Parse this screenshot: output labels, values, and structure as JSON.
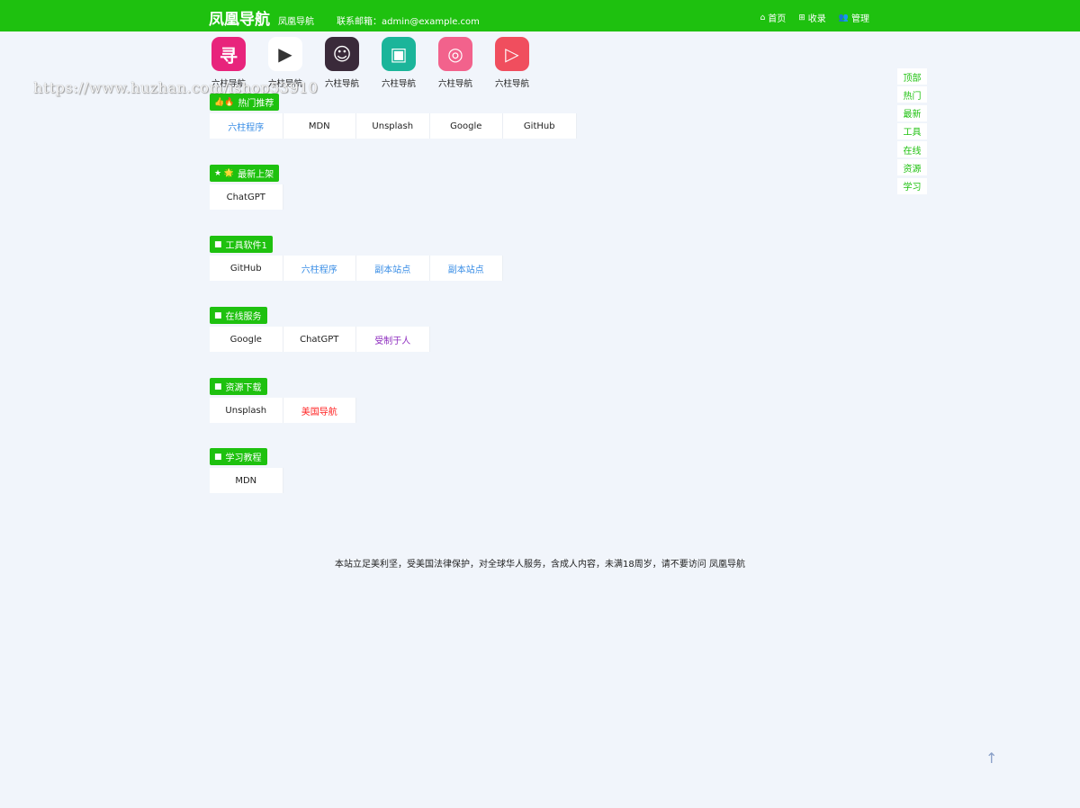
{
  "header": {
    "brand": "凤凰导航",
    "brand_sub": "凤凰导航",
    "contact": "联系邮箱：admin@example.com",
    "nav": [
      {
        "icon": "home-icon",
        "glyph": "⌂",
        "label": "首页"
      },
      {
        "icon": "plus-square-icon",
        "glyph": "⊞",
        "label": "收录"
      },
      {
        "icon": "users-icon",
        "glyph": "👥",
        "label": "管理"
      }
    ]
  },
  "watermark": "https://www.huzhan.com/ishop53910",
  "apps": [
    {
      "label": "六柱导航",
      "color": "#e8247c",
      "glyph": "寻"
    },
    {
      "label": "六柱导航",
      "color": "#ffffff",
      "glyph": "▶"
    },
    {
      "label": "六柱导航",
      "color": "#3a2a3a",
      "glyph": "☺"
    },
    {
      "label": "六柱导航",
      "color": "#1bb59a",
      "glyph": "▣"
    },
    {
      "label": "六柱导航",
      "color": "#f2628c",
      "glyph": "◎"
    },
    {
      "label": "六柱导航",
      "color": "#f04e5e",
      "glyph": "▷"
    }
  ],
  "sections": [
    {
      "id": "hot",
      "icon": "thumbs-up-icon",
      "glyph": "👍🔥",
      "title": "热门推荐",
      "links": [
        {
          "text": "六柱程序",
          "style": "blue"
        },
        {
          "text": "MDN",
          "style": ""
        },
        {
          "text": "Unsplash",
          "style": ""
        },
        {
          "text": "Google",
          "style": ""
        },
        {
          "text": "GitHub",
          "style": ""
        }
      ]
    },
    {
      "id": "new",
      "icon": "star-icon",
      "glyph": "★ 🌟",
      "title": "最新上架",
      "links": [
        {
          "text": "ChatGPT",
          "style": ""
        }
      ]
    },
    {
      "id": "tools",
      "icon": "folder-icon",
      "glyph": "■",
      "title": "工具软件1",
      "links": [
        {
          "text": "GitHub",
          "style": ""
        },
        {
          "text": "六柱程序",
          "style": "blue"
        },
        {
          "text": "副本站点",
          "style": "blue"
        },
        {
          "text": "副本站点",
          "style": "blue"
        }
      ]
    },
    {
      "id": "online",
      "icon": "folder-icon",
      "glyph": "■",
      "title": "在线服务",
      "links": [
        {
          "text": "Google",
          "style": ""
        },
        {
          "text": "ChatGPT",
          "style": ""
        },
        {
          "text": "受制于人",
          "style": "purple"
        }
      ]
    },
    {
      "id": "download",
      "icon": "folder-icon",
      "glyph": "■",
      "title": "资源下载",
      "links": [
        {
          "text": "Unsplash",
          "style": ""
        },
        {
          "text": "美国导航",
          "style": "red"
        }
      ]
    },
    {
      "id": "learn",
      "icon": "folder-icon",
      "glyph": "■",
      "title": "学习教程",
      "links": [
        {
          "text": "MDN",
          "style": ""
        }
      ]
    }
  ],
  "sidenav": [
    "顶部",
    "热门",
    "最新",
    "工具",
    "在线",
    "资源",
    "学习"
  ],
  "footer": "本站立足美利坚，受美国法律保护，对全球华人服务，含成人内容，未满18周岁，请不要访问 凤凰导航",
  "backtop": "↑",
  "colors": {
    "accent": "#1ec10f",
    "background": "#f1f5fb",
    "link_blue": "#3a8ee6",
    "link_purple": "#8e2dbf",
    "link_red": "#ff2222"
  }
}
